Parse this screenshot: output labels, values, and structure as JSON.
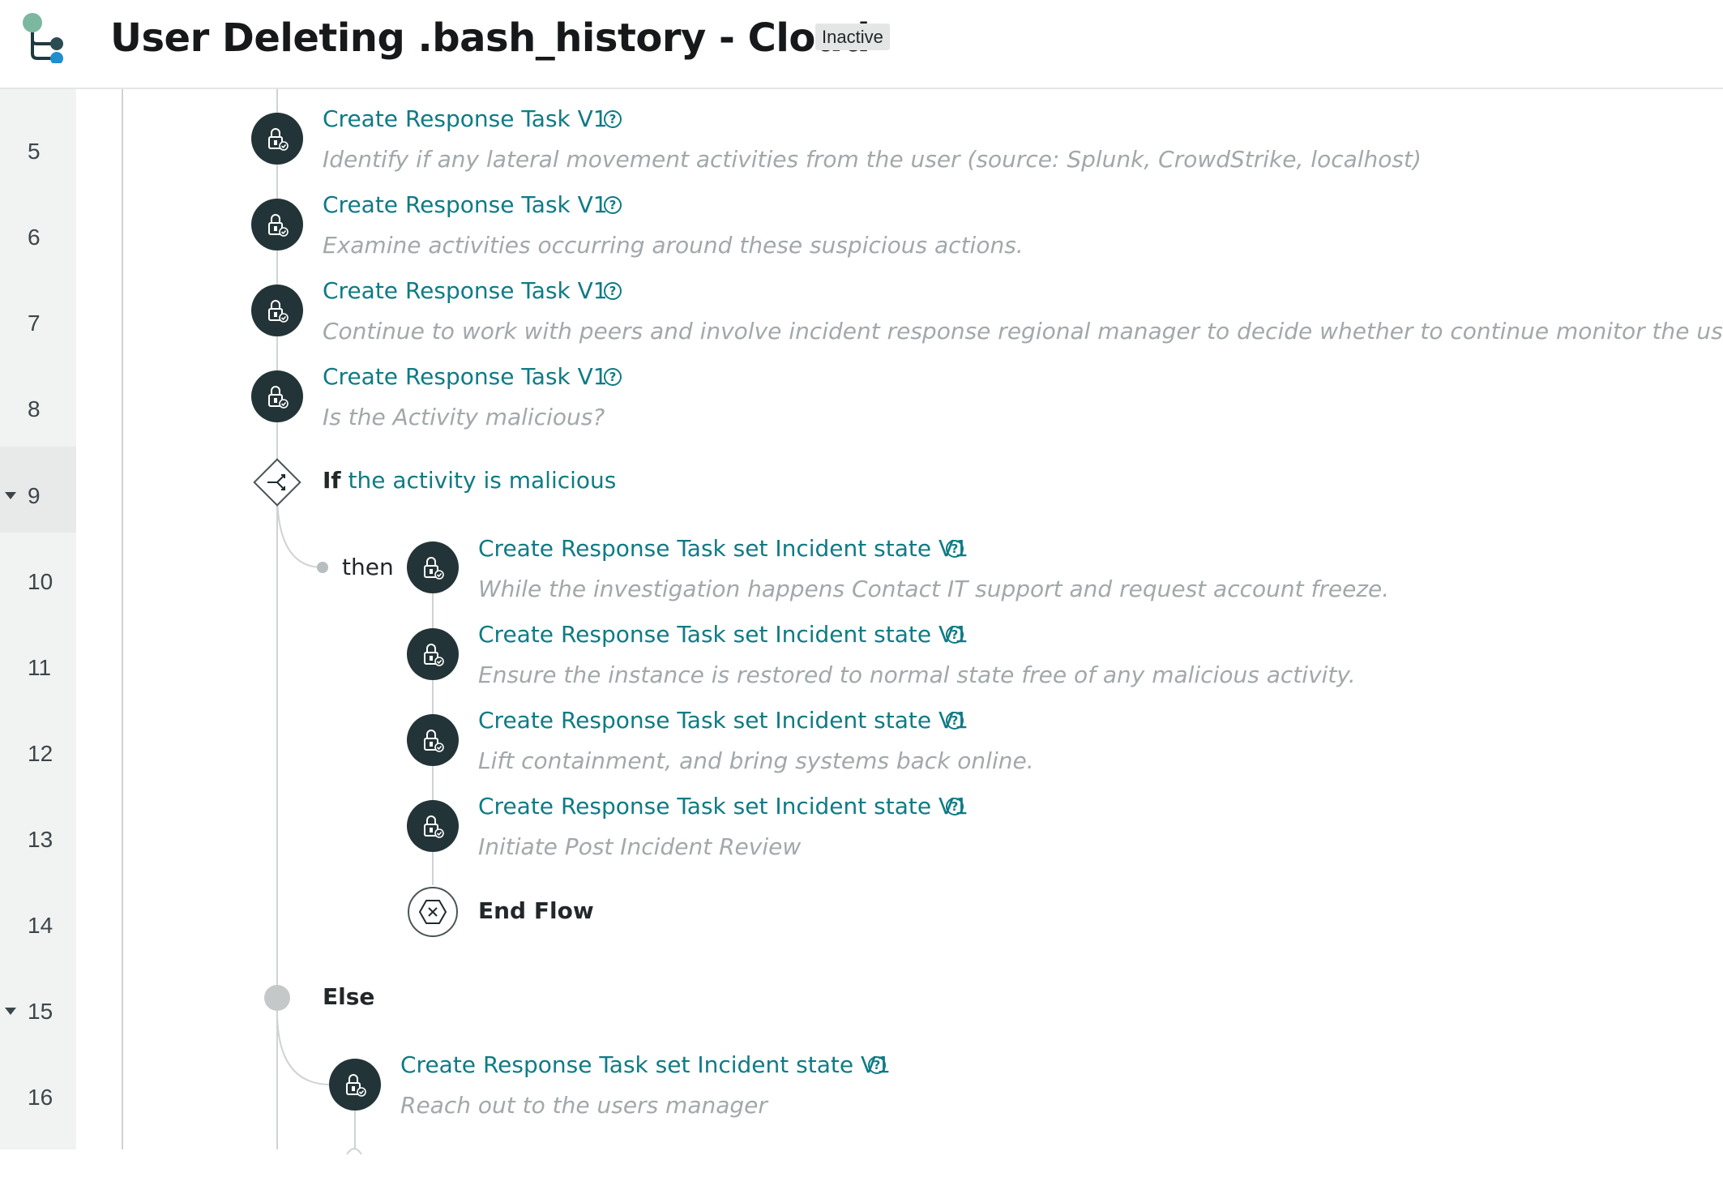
{
  "header": {
    "title": "User Deleting .bash_history - Cloud",
    "status_badge": "Inactive",
    "logo_icon": "flow-logo-icon"
  },
  "gutter": {
    "lines": [
      "5",
      "6",
      "7",
      "8",
      "9",
      "10",
      "11",
      "12",
      "13",
      "14",
      "15",
      "16"
    ],
    "collapsible_lines": [
      "9",
      "15"
    ]
  },
  "steps": [
    {
      "line": "5",
      "title": "Create Response Task V1",
      "description": "Identify if any lateral movement activities from the user (source: Splunk, CrowdStrike, localhost)",
      "icon": "lock-task-icon"
    },
    {
      "line": "6",
      "title": "Create Response Task V1",
      "description": "Examine activities occurring around these suspicious actions.",
      "icon": "lock-task-icon"
    },
    {
      "line": "7",
      "title": "Create Response Task V1",
      "description": "Continue to work with peers and involve incident response regional manager to decide whether to continue monitor the user",
      "icon": "lock-task-icon"
    },
    {
      "line": "8",
      "title": "Create Response Task V1",
      "description": "Is the Activity malicious?",
      "icon": "lock-task-icon"
    }
  ],
  "condition": {
    "line": "9",
    "keyword": "If",
    "text": "the activity is malicious",
    "icon": "branch-icon"
  },
  "then_label": "then",
  "then_steps": [
    {
      "line": "10",
      "title": "Create Response Task set Incident state V1",
      "description": "While the investigation happens Contact IT support and request account freeze.",
      "icon": "lock-task-icon"
    },
    {
      "line": "11",
      "title": "Create Response Task set Incident state V1",
      "description": "Ensure the instance is restored to normal state free of any malicious activity.",
      "icon": "lock-task-icon"
    },
    {
      "line": "12",
      "title": "Create Response Task set Incident state V1",
      "description": "Lift containment, and bring systems back online.",
      "icon": "lock-task-icon"
    },
    {
      "line": "13",
      "title": "Create Response Task set Incident state V1",
      "description": "Initiate Post Incident Review",
      "icon": "lock-task-icon"
    }
  ],
  "end_flow": {
    "line": "14",
    "label": "End Flow",
    "icon": "end-flow-icon"
  },
  "else_block": {
    "line": "15",
    "label": "Else"
  },
  "else_steps": [
    {
      "line": "16",
      "title": "Create Response Task set Incident state V1",
      "description": "Reach out to the users manager",
      "icon": "lock-task-icon"
    }
  ],
  "help_glyph": "?",
  "colors": {
    "accent": "#0e7b85",
    "task_icon_bg": "#233438",
    "description": "#a2a8aa",
    "gutter_bg": "#f1f2f2"
  }
}
